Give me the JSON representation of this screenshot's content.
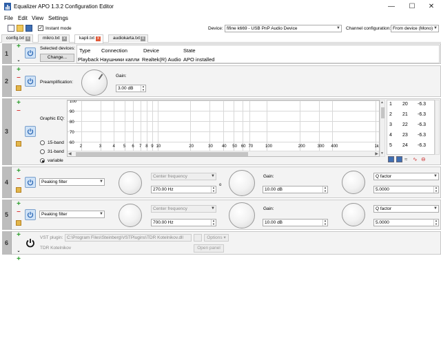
{
  "window": {
    "title": "Equalizer APO 1.3.2 Configuration Editor",
    "minimize": "—",
    "maximize": "☐",
    "close": "✕"
  },
  "menu": [
    "File",
    "Edit",
    "View",
    "Settings"
  ],
  "toolbar": {
    "instant_mode_label": "Instant mode",
    "instant_mode_checked": true,
    "device_label": "Device:",
    "device_value": "fifine k669 - USB PnP Audio Device",
    "channel_label": "Channel configuration:",
    "channel_value": "From device (Mono)"
  },
  "tabs": [
    {
      "label": "config.txt",
      "active": false
    },
    {
      "label": "mikro.txt",
      "active": false
    },
    {
      "label": "kapli.txt",
      "active": true
    },
    {
      "label": "audiokarta.txt",
      "active": false
    }
  ],
  "panels": {
    "p1": {
      "number": "1",
      "selected_label": "Selected devices:",
      "change_button": "Change...",
      "table_headers": [
        "Type",
        "Connection",
        "Device",
        "State"
      ],
      "table_row": [
        "Playback",
        "Наушники капли",
        "Realtek(R) Audio",
        "APO installed"
      ]
    },
    "p2": {
      "number": "2",
      "preamp_label": "Preamplification:",
      "gain_label": "Gain:",
      "gain_value": "3.00 dB"
    },
    "p3": {
      "number": "3",
      "graphic_label": "Graphic EQ:",
      "y_ticks": [
        "100",
        "90",
        "80",
        "70",
        "60"
      ],
      "x_ticks": [
        "2",
        "3",
        "4",
        "5",
        "6",
        "7",
        "8",
        "9",
        "10",
        "20",
        "30",
        "40",
        "50",
        "60",
        "70",
        "100",
        "200",
        "300",
        "400",
        "1k"
      ],
      "band_options": [
        "15-band",
        "31-band",
        "variable"
      ],
      "band_selected": "variable",
      "band_rows": [
        [
          "1",
          "20",
          "-6.3"
        ],
        [
          "2",
          "21",
          "-6.3"
        ],
        [
          "3",
          "22",
          "-6.3"
        ],
        [
          "4",
          "23",
          "-6.3"
        ],
        [
          "5",
          "24",
          "-6.3"
        ]
      ]
    },
    "p4": {
      "number": "4",
      "filter_type": "Peaking filter",
      "freq_mode": "Center frequency",
      "freq_value": "270.00 Hz",
      "gain_label": "Gain:",
      "gain_value": "10.00 dB",
      "q_mode": "Q factor",
      "q_value": "5.0000"
    },
    "p5": {
      "number": "5",
      "filter_type": "Peaking filter",
      "freq_mode": "Center frequency",
      "freq_value": "700.00 Hz",
      "gain_label": "Gain:",
      "gain_value": "10.00 dB",
      "q_mode": "Q factor",
      "q_value": "5.0000"
    },
    "p6": {
      "number": "6",
      "vst_label": "VST plugin:",
      "vst_path": "C:\\Program Files\\Steinberg\\VSTPlugins\\TDR Kotelnikov.dll",
      "options_label": "Options",
      "plugin_name": "TDR Kotelnikov",
      "open_panel": "Open panel"
    }
  },
  "colors": {
    "accent_green": "#2a9d2a",
    "remove_red": "#dd3333",
    "number_bar": "#bdbdbd"
  }
}
